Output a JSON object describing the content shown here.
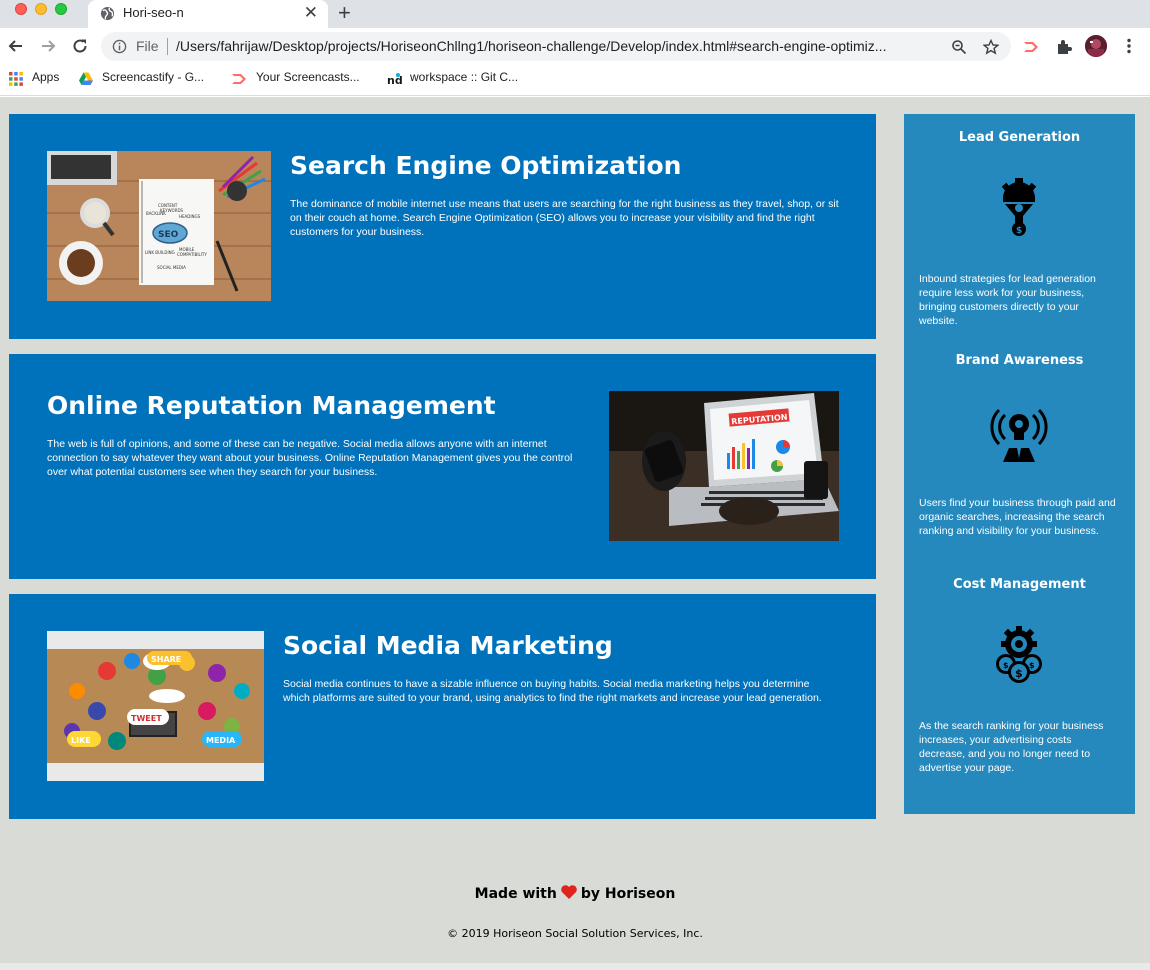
{
  "browser": {
    "tab_title": "Hori-seo-n",
    "tab_close": "✕",
    "new_tab": "+",
    "file_label": "File",
    "url": "/Users/fahrijaw/Desktop/projects/HoriseonChllng1/horiseon-challenge/Develop/index.html#search-engine-optimiz...",
    "bookmarks": [
      "Apps",
      "Screencastify - G...",
      "Your Screencasts...",
      "workspace :: Git C..."
    ]
  },
  "sections": [
    {
      "title": "Search Engine Optimization",
      "text": "The dominance of mobile internet use means that users are searching for the right business as they travel, shop, or sit on their couch at home. Search Engine Optimization (SEO) allows you to increase your visibility and find the right customers for your business."
    },
    {
      "title": "Online Reputation Management",
      "text": "The web is full of opinions, and some of these can be negative. Social media allows anyone with an internet connection to say whatever they want about your business. Online Reputation Management gives you the control over what potential customers see when they search for your business."
    },
    {
      "title": "Social Media Marketing",
      "text": "Social media continues to have a sizable influence on buying habits. Social media marketing helps you determine which platforms are suited to your brand, using analytics to find the right markets and increase your lead generation."
    }
  ],
  "images": {
    "seo_words": [
      "SEO",
      "CONTENT",
      "BACKLINK",
      "KEYWORDS",
      "HEADINGS",
      "MOBILE",
      "COMPATIBILITY",
      "LINK BUILDING",
      "SOCIAL MEDIA"
    ],
    "reputation_banner": "REPUTATION",
    "social_bubbles": [
      "SHARE",
      "TWEET",
      "LIKE",
      "MEDIA"
    ]
  },
  "benefits": [
    {
      "title": "Lead Generation",
      "icon": "lead-funnel-icon",
      "text": "Inbound strategies for lead generation require less work for your business, bringing customers directly to your website."
    },
    {
      "title": "Brand Awareness",
      "icon": "brand-lightbulb-icon",
      "text": "Users find your business through paid and organic searches, increasing the search ranking and visibility for your business."
    },
    {
      "title": "Cost Management",
      "icon": "cost-gear-coins-icon",
      "text": "As the search ranking for your business increases, your advertising costs decrease, and you no longer need to advertise your page."
    }
  ],
  "footer": {
    "made_with": "Made with",
    "by": "by Horiseon",
    "copyright": "© 2019 Horiseon Social Solution Services, Inc."
  },
  "colors": {
    "section_bg": "#0072bb",
    "benefits_bg": "#2589bd",
    "page_bg": "#d9dcd6"
  }
}
